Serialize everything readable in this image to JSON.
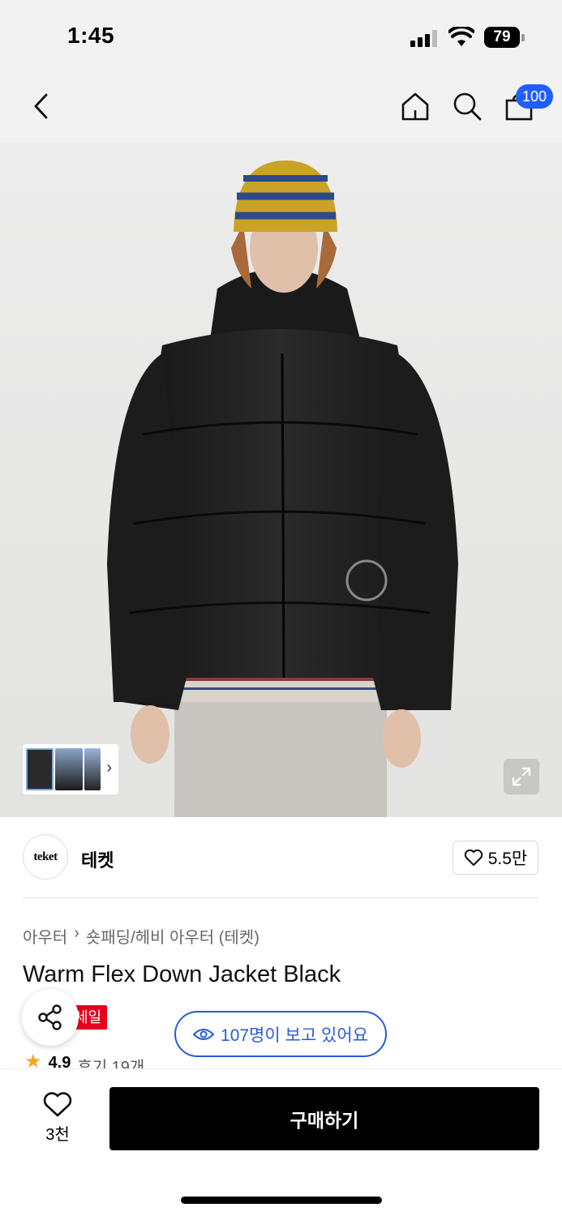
{
  "status_bar": {
    "time": "1:45",
    "battery": "79"
  },
  "nav": {
    "cart_count": "100"
  },
  "icons": {
    "back": "chevron-left-icon",
    "home": "home-icon",
    "search": "search-icon",
    "bag": "shopping-bag-icon",
    "expand": "expand-icon",
    "heart": "heart-icon",
    "share": "share-icon",
    "eye": "eye-icon",
    "star": "star-icon"
  },
  "brand": {
    "logo_text": "teket",
    "name": "테켓",
    "likes": "5.5만"
  },
  "breadcrumb": [
    "아우터",
    "숏패딩/헤비 아우터 (테켓)"
  ],
  "product": {
    "title": "Warm Flex Down Jacket Black",
    "sale_badge": "세일",
    "rating": "4.9",
    "reviews": "후기 19개"
  },
  "viewers": "107명이 보고 있어요",
  "bottom": {
    "wish_count": "3천",
    "buy_label": "구매하기"
  },
  "colors": {
    "accent_blue": "#2a5bd7",
    "badge_blue": "#1f5eff",
    "sale_red": "#e8001c",
    "star": "#f5a623"
  }
}
